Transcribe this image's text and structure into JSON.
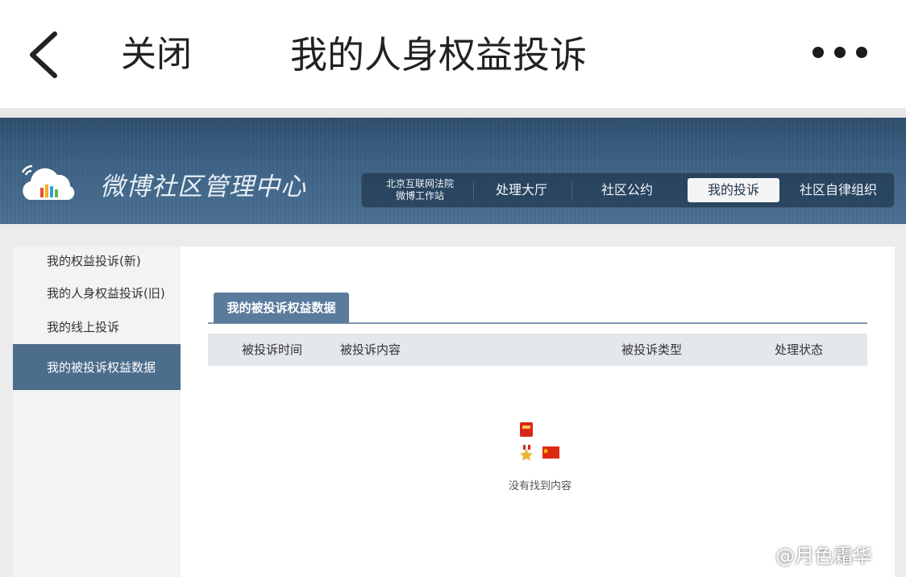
{
  "topbar": {
    "close_label": "关闭",
    "title": "我的人身权益投诉"
  },
  "header": {
    "site_name": "微博社区管理中心",
    "court_line1": "北京互联网法院",
    "court_line2": "微博工作站",
    "nav": [
      {
        "label": "处理大厅",
        "active": false
      },
      {
        "label": "社区公约",
        "active": false
      },
      {
        "label": "我的投诉",
        "active": true
      },
      {
        "label": "社区自律组织",
        "active": false
      }
    ]
  },
  "sidebar": {
    "items": [
      {
        "label": "我的权益投诉(新)",
        "active": false
      },
      {
        "label": "我的人身权益投诉(旧)",
        "active": false
      },
      {
        "label": "我的线上投诉",
        "active": false
      },
      {
        "label": "我的被投诉权益数据",
        "active": true
      }
    ]
  },
  "main": {
    "tab_label": "我的被投诉权益数据",
    "columns": [
      "被投诉时间",
      "被投诉内容",
      "被投诉类型",
      "处理状态"
    ],
    "empty_text": "没有找到内容"
  },
  "watermark": {
    "text": "@月色霜华"
  },
  "colors": {
    "banner": "#3e6385",
    "active_sidebar": "#4d6d8d",
    "tab": "#5a7b9c",
    "table_header": "#e4e7eb"
  }
}
